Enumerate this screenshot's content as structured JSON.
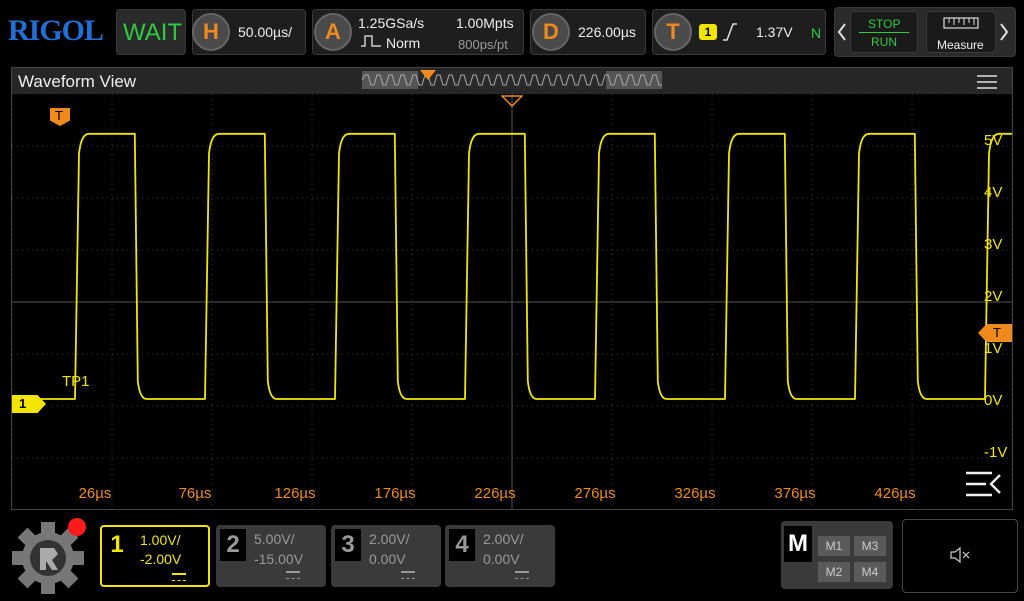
{
  "brand": "RIGOL",
  "status": "WAIT",
  "horizontal": {
    "label": "H",
    "scale": "50.00µs/"
  },
  "acquire": {
    "label": "A",
    "sample_rate": "1.25GSa/s",
    "mode": "Norm",
    "memory": "1.00Mpts",
    "resolution": "800ps/pt"
  },
  "delay": {
    "label": "D",
    "value": "226.00µs"
  },
  "trigger": {
    "label": "T",
    "source": "1",
    "level": "1.37V",
    "mode": "N"
  },
  "run_control": {
    "stop": "STOP",
    "run": "RUN"
  },
  "measure": {
    "label": "Measure"
  },
  "waveform_view": {
    "title": "Waveform View",
    "channel_label": "TP1",
    "channel_marker": "1",
    "trigger_marker": "T",
    "trigger_level_marker": "T",
    "volt_ticks": [
      "5V",
      "4V",
      "3V",
      "2V",
      "1V",
      "0V",
      "-1V"
    ],
    "time_ticks": [
      "26µs",
      "76µs",
      "126µs",
      "176µs",
      "226µs",
      "276µs",
      "326µs",
      "376µs",
      "426µs"
    ]
  },
  "signal": {
    "color": "#f2e600",
    "low_v": 0.0,
    "high_v": 5.1,
    "period_us": 65,
    "duty": 0.46
  },
  "channels": [
    {
      "num": "1",
      "scale": "1.00V/",
      "offset": "-2.00V",
      "active": true
    },
    {
      "num": "2",
      "scale": "5.00V/",
      "offset": "-15.00V",
      "active": false
    },
    {
      "num": "3",
      "scale": "2.00V/",
      "offset": "0.00V",
      "active": false
    },
    {
      "num": "4",
      "scale": "2.00V/",
      "offset": "0.00V",
      "active": false
    }
  ],
  "math": {
    "label": "M",
    "items": [
      "M1",
      "M3",
      "M2",
      "M4"
    ]
  },
  "colors": {
    "accent": "#f08a1c",
    "channel1": "#f2e600",
    "run_green": "#2ecc40"
  }
}
